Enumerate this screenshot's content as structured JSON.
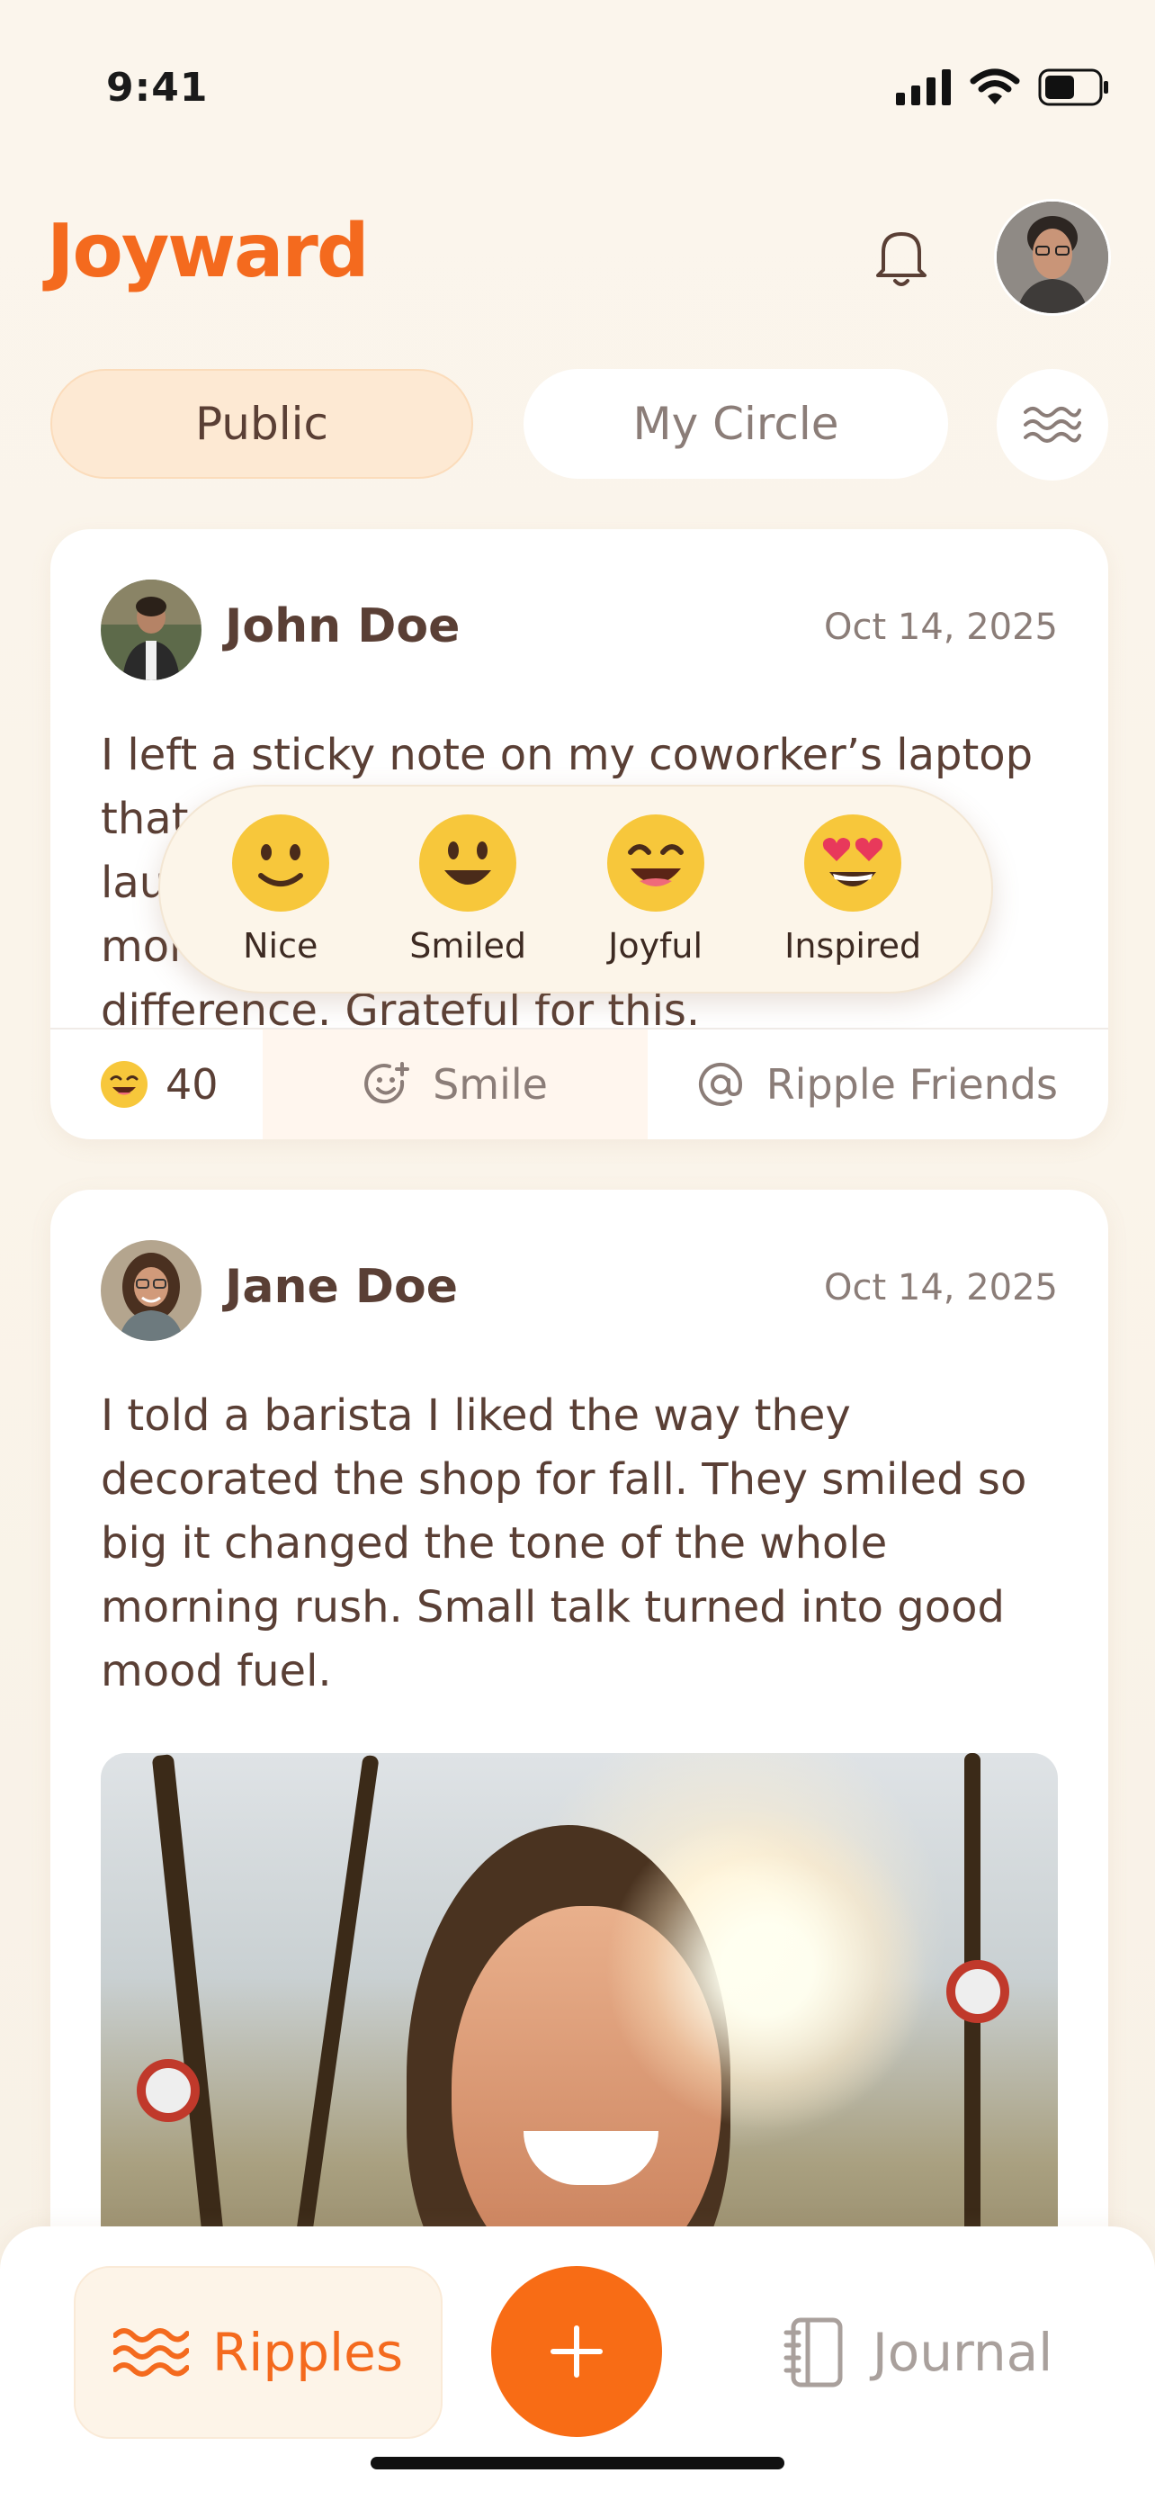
{
  "status_bar": {
    "time": "9:41"
  },
  "header": {
    "logo": "Joyward"
  },
  "tabs": [
    {
      "label": "Public"
    },
    {
      "label": "My Circle"
    }
  ],
  "posts": [
    {
      "author": "John Doe",
      "date": "Oct 14, 2025",
      "text": "I left a sticky note on my coworker’s laptop that said “You’re doing great!” They laughed out loud and said it made their morning. Such a small thing made a difference. Grateful for this.",
      "reaction_count": "40",
      "smile_label": "Smile",
      "ripple_label": "Ripple Friends"
    },
    {
      "author": "Jane Doe",
      "date": "Oct 14, 2025",
      "text": "I told a barista I liked the way they decorated the shop for fall. They smiled so big it changed the tone of the whole morning rush. Small talk turned into good mood fuel."
    }
  ],
  "reactions": [
    {
      "label": "Nice"
    },
    {
      "label": "Smiled"
    },
    {
      "label": "Joyful"
    },
    {
      "label": "Inspired"
    }
  ],
  "bottom_nav": {
    "ripples": "Ripples",
    "journal": "Journal"
  },
  "colors": {
    "accent": "#f46a1e",
    "text": "#5a3f35",
    "muted": "#8b7d78"
  }
}
